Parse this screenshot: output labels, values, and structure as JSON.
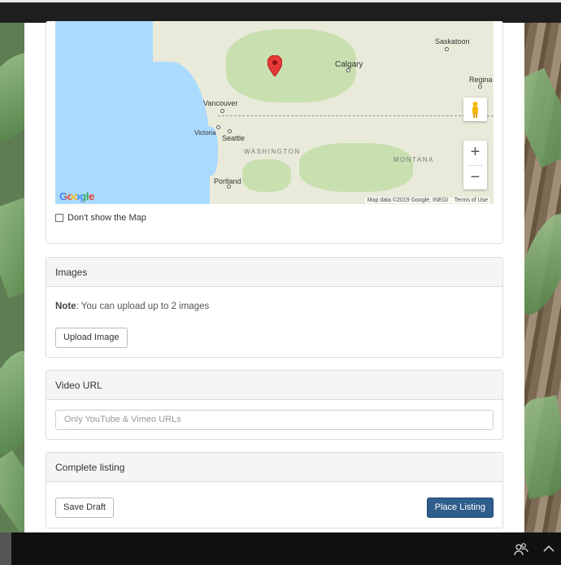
{
  "map": {
    "cities": {
      "saskatoon": "Saskatoon",
      "calgary": "Calgary",
      "regina": "Regina",
      "vancouver": "Vancouver",
      "victoria": "Victoria",
      "seattle": "Seattle",
      "portland": "Portland"
    },
    "states": {
      "washington": "WASHINGTON",
      "montana": "MONTANA"
    },
    "zoom_in": "+",
    "zoom_out": "−",
    "google": "Google",
    "attribution": "Map data ©2019 Google, INEGI",
    "terms": "Terms of Use"
  },
  "dont_show_map_label": "Don't show the Map",
  "images_panel": {
    "title": "Images",
    "note_bold": "Note",
    "note_text": ": You can upload up to 2 images",
    "upload_label": "Upload Image"
  },
  "video_panel": {
    "title": "Video URL",
    "placeholder": "Only YouTube & Vimeo URLs"
  },
  "complete_panel": {
    "title": "Complete listing",
    "save_label": "Save Draft",
    "place_label": "Place Listing"
  },
  "colors": {
    "primary_button": "#2f5d8c",
    "water": "#aadaff",
    "pin": "#e53935"
  }
}
